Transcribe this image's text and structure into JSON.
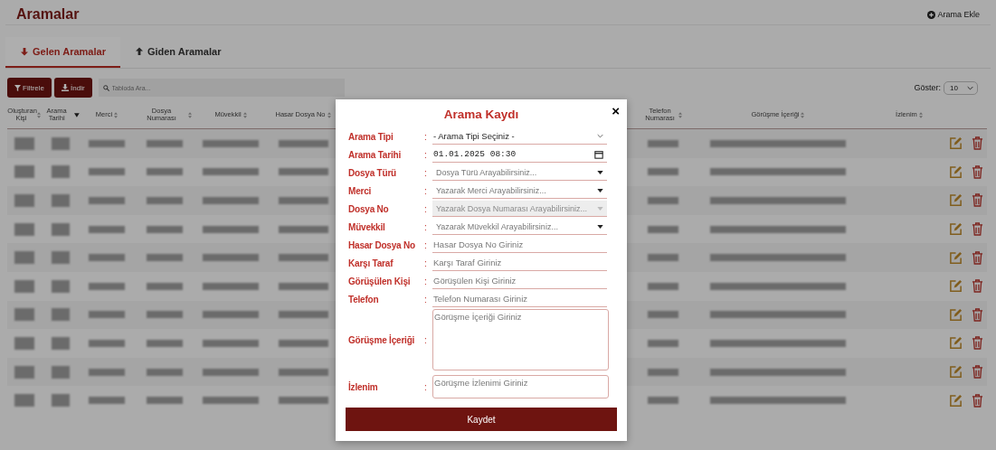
{
  "page": {
    "title": "Aramalar",
    "add_button": "Arama Ekle"
  },
  "tabs": [
    {
      "label": "Gelen Aramalar",
      "selected": true
    },
    {
      "label": "Giden Aramalar",
      "selected": false
    }
  ],
  "toolbar": {
    "filter_button": "Filtrele",
    "download_button": "İndir",
    "search": {
      "placeholder": "Tabloda Ara..."
    },
    "show_label": "Göster:",
    "show_value": "10"
  },
  "table": {
    "columns": [
      {
        "label": "Oluşturan Kişi",
        "sorted": false
      },
      {
        "label": "Arama Tarihi",
        "sorted": true
      },
      {
        "label": "Merci",
        "sorted": false
      },
      {
        "label": "Dosya Numarası",
        "sorted": false
      },
      {
        "label": "Müvekkil",
        "sorted": false
      },
      {
        "label": "Hasar Dosya No",
        "sorted": false
      },
      {
        "label": "Telefon Numarası",
        "sorted": false
      },
      {
        "label": "Görüşme İçeriği",
        "sorted": false
      },
      {
        "label": "İzlenim",
        "sorted": false
      }
    ],
    "rows": [
      {
        "kind": "blurred"
      },
      {
        "kind": "blurred"
      },
      {
        "kind": "blurred"
      },
      {
        "kind": "blurred"
      },
      {
        "kind": "blurred"
      },
      {
        "kind": "blurred"
      },
      {
        "kind": "blurred"
      },
      {
        "kind": "blurred"
      },
      {
        "kind": "blurred"
      },
      {
        "kind": "blurred"
      }
    ]
  },
  "modal": {
    "title": "Arama Kaydı",
    "close": "×",
    "save_button": "Kaydet",
    "separator": ":",
    "fields": [
      {
        "label": "Arama Tipi",
        "kind": "select",
        "value": "- Arama Tipi Seçiniz -",
        "disabled": false
      },
      {
        "label": "Arama Tarihi",
        "kind": "datetime",
        "value": "01.01.2025 08:30",
        "disabled": false
      },
      {
        "label": "Dosya Türü",
        "kind": "combo",
        "placeholder": "Dosya Türü Arayabilirsiniz...",
        "disabled": false
      },
      {
        "label": "Merci",
        "kind": "combo",
        "placeholder": "Yazarak Merci Arayabilirsiniz...",
        "disabled": false
      },
      {
        "label": "Dosya No",
        "kind": "combo",
        "placeholder": "Yazarak Dosya Numarası Arayabilirsiniz...",
        "disabled": true
      },
      {
        "label": "Müvekkil",
        "kind": "combo",
        "placeholder": "Yazarak Müvekkil Arayabilirsiniz...",
        "disabled": false
      },
      {
        "label": "Hasar Dosya No",
        "kind": "text",
        "placeholder": "Hasar Dosya No Giriniz",
        "disabled": false
      },
      {
        "label": "Karşı Taraf",
        "kind": "text",
        "placeholder": "Karşı Taraf Giriniz",
        "disabled": false
      },
      {
        "label": "Görüşülen Kişi",
        "kind": "text",
        "placeholder": "Görüşülen Kişi Giriniz",
        "disabled": false
      },
      {
        "label": "Telefon",
        "kind": "text",
        "placeholder": "Telefon Numarası Giriniz",
        "disabled": false
      },
      {
        "label": "Görüşme İçeriği",
        "kind": "textarea",
        "placeholder": "Görüşme İçeriği Giriniz",
        "disabled": false
      },
      {
        "label": "İzlenim",
        "kind": "textarea-small",
        "placeholder": "Görüşme İzlenimi Giriniz",
        "disabled": false
      }
    ]
  }
}
